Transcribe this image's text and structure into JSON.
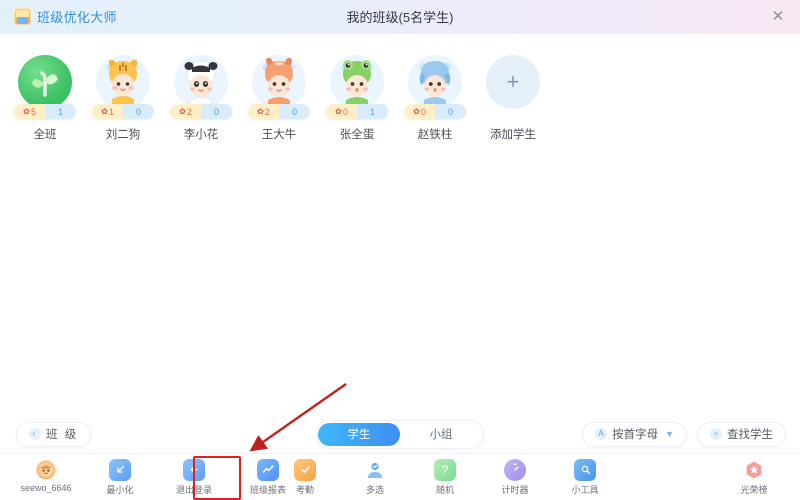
{
  "window": {
    "brand_name": "班级优化大师",
    "brand_logo_icon": "app-logo-icon",
    "title": "我的班级(5名学生)",
    "close_icon": "✕"
  },
  "roster": {
    "students": [
      {
        "name": "全班",
        "positive": "5",
        "negative": "1",
        "avatar": "sprout-avatar",
        "flower_icon": "✿"
      },
      {
        "name": "刘二狗",
        "positive": "1",
        "negative": "0",
        "avatar": "tiger-avatar",
        "flower_icon": "✿"
      },
      {
        "name": "李小花",
        "positive": "2",
        "negative": "0",
        "avatar": "panda-avatar",
        "flower_icon": "✿"
      },
      {
        "name": "王大牛",
        "positive": "2",
        "negative": "0",
        "avatar": "fox-avatar",
        "flower_icon": "✿"
      },
      {
        "name": "张全蛋",
        "positive": "0",
        "negative": "1",
        "avatar": "frog-avatar",
        "flower_icon": "✿"
      },
      {
        "name": "赵铁柱",
        "positive": "0",
        "negative": "0",
        "avatar": "penguin-avatar",
        "flower_icon": "✿"
      }
    ],
    "add_student": {
      "label": "添加学生",
      "icon": "plus-icon",
      "symbol": "+"
    }
  },
  "subbar": {
    "class_button": {
      "label": "班 级",
      "icon": "chevron-left-icon",
      "symbol": "‹"
    },
    "segmented": {
      "student_label": "学生",
      "group_label": "小组",
      "active": "学生"
    },
    "sort_button": {
      "label": "按首字母",
      "icon": "alpha-icon",
      "symbol": "A",
      "chevron": "▼"
    },
    "find_button": {
      "label": "查找学生",
      "icon": "search-icon",
      "symbol": "⌕"
    }
  },
  "dock": {
    "left_items": [
      {
        "label": "seewo_6646",
        "icon": "account-avatar-icon",
        "symbol": ""
      },
      {
        "label": "最小化",
        "icon": "minimize-icon",
        "symbol": "↙"
      },
      {
        "label": "退出登录",
        "icon": "logout-icon",
        "symbol": "←"
      },
      {
        "label": "班级报表",
        "icon": "chart-report-icon",
        "symbol": "∿"
      }
    ],
    "center_items": [
      {
        "label": "考勤",
        "icon": "check-icon",
        "symbol": "✓"
      },
      {
        "label": "多选",
        "icon": "users-icon",
        "symbol": ""
      },
      {
        "label": "随机",
        "icon": "random-icon",
        "symbol": "?"
      },
      {
        "label": "计时器",
        "icon": "timer-icon",
        "symbol": ""
      },
      {
        "label": "小工具",
        "icon": "toolbox-icon",
        "symbol": ""
      }
    ],
    "right_item": {
      "label": "光荣榜",
      "icon": "honor-badge-icon",
      "symbol": "★"
    }
  },
  "annotation": {
    "highlight_target": "班级报表",
    "arrow_color": "#c0201f",
    "box_color": "#e02020"
  },
  "colors": {
    "accent_blue": "#3d8ef5",
    "header_left": "#e3f1fb",
    "header_right": "#f7e9f4",
    "badge_positive_bg": "#fdf0c9",
    "badge_negative_bg": "#d9ecfb"
  }
}
